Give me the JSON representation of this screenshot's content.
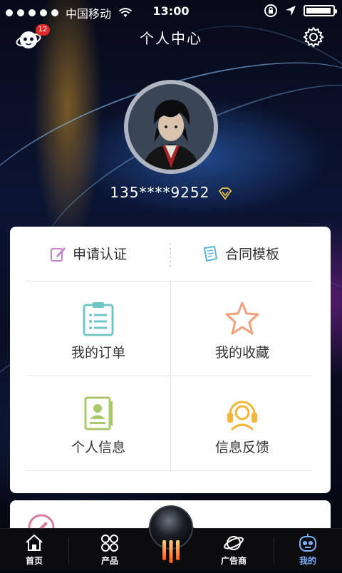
{
  "status_bar": {
    "carrier": "中国移动",
    "time": "13:00"
  },
  "header": {
    "title": "个人中心",
    "message_badge": "12"
  },
  "profile": {
    "username": "135****9252"
  },
  "card": {
    "top_actions": [
      {
        "label": "申请认证",
        "icon": "edit-certify-icon"
      },
      {
        "label": "合同模板",
        "icon": "contract-template-icon"
      }
    ],
    "grid": [
      {
        "label": "我的订单",
        "icon": "clipboard-order-icon",
        "color": "#6fc7c5"
      },
      {
        "label": "我的收藏",
        "icon": "star-icon",
        "color": "#f0a07a"
      },
      {
        "label": "个人信息",
        "icon": "id-card-icon",
        "color": "#a9c96a"
      },
      {
        "label": "信息反馈",
        "icon": "headset-icon",
        "color": "#f2b63b"
      }
    ]
  },
  "tab_bar": {
    "tabs": [
      {
        "label": "首页",
        "icon": "home-icon"
      },
      {
        "label": "产品",
        "icon": "products-icon"
      },
      {
        "label": "广告商",
        "icon": "planet-icon"
      },
      {
        "label": "我的",
        "icon": "robot-icon",
        "active": true
      }
    ],
    "accent": "#7fb0ff"
  }
}
